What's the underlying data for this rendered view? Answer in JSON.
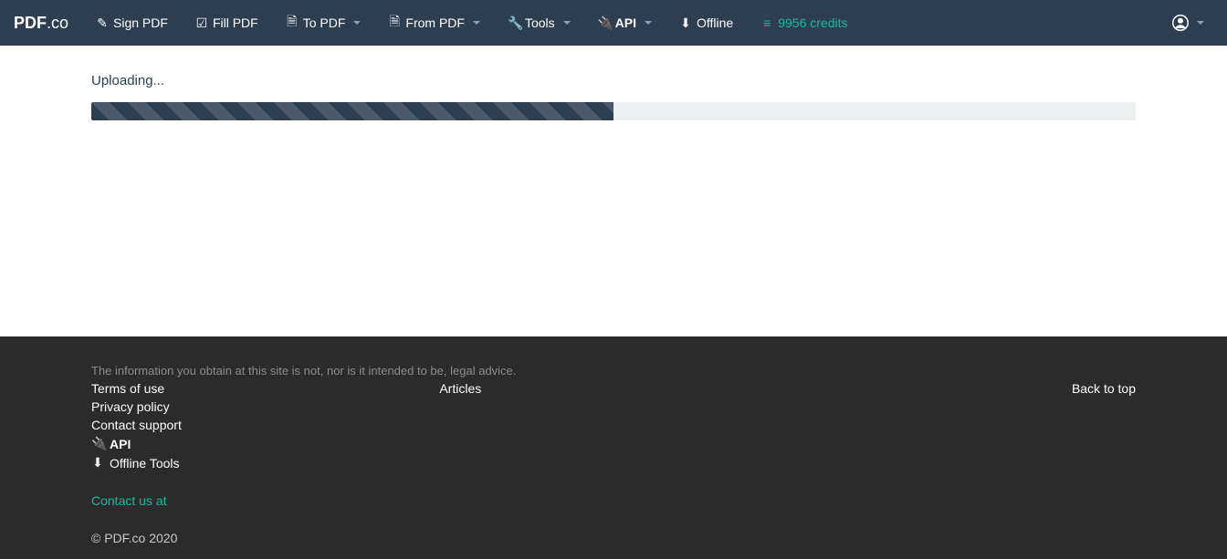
{
  "logo": {
    "bold": "PDF",
    "light": ".co"
  },
  "nav": {
    "sign": "Sign PDF",
    "fill": "Fill PDF",
    "topdf": "To PDF",
    "frompdf": "From PDF",
    "tools": "Tools",
    "api": "API",
    "offline": "Offline",
    "credits": "9956 credits"
  },
  "main": {
    "status": "Uploading...",
    "progress_percent": 50
  },
  "footer": {
    "disclaimer": "The information you obtain at this site is not, nor is it intended to be, legal advice.",
    "terms": "Terms of use",
    "privacy": "Privacy policy",
    "support": "Contact support",
    "api": "API",
    "offline_tools": "Offline Tools",
    "articles": "Articles",
    "back_to_top": "Back to top",
    "contact": "Contact us at",
    "copyright": "© PDF.co 2020"
  }
}
